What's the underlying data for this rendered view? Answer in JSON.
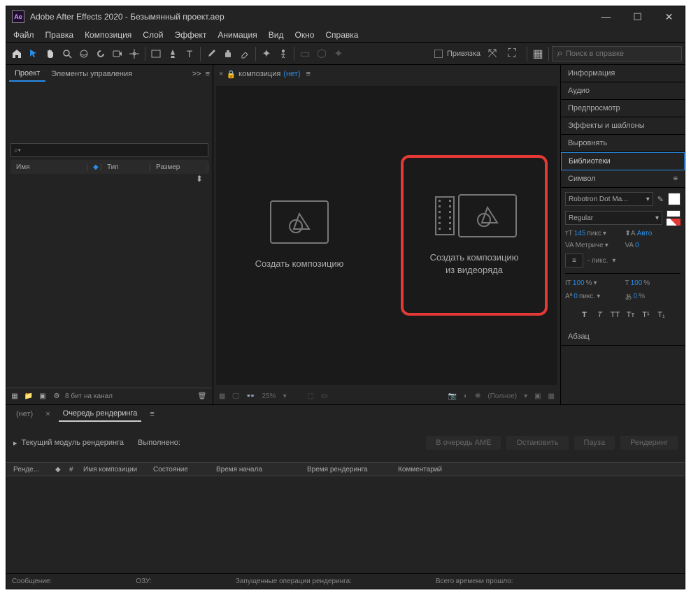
{
  "app": {
    "icon_text": "Ae",
    "title": "Adobe After Effects 2020 - Безымянный проект.aep"
  },
  "menu": {
    "file": "Файл",
    "edit": "Правка",
    "comp": "Композиция",
    "layer": "Слой",
    "effect": "Эффект",
    "anim": "Анимация",
    "view": "Вид",
    "window": "Окно",
    "help": "Справка"
  },
  "toolbar": {
    "snap_label": "Привязка"
  },
  "search": {
    "placeholder": "Поиск в справке"
  },
  "left": {
    "tab_project": "Проект",
    "tab_controls": "Элементы управления",
    "more": ">>",
    "col_name": "Имя",
    "col_type": "Тип",
    "col_size": "Размер",
    "footer_bpc": "8 бит на канал"
  },
  "center": {
    "comp_label": "композиция",
    "comp_none": "(нет)",
    "create_comp": "Создать композицию",
    "create_from": "Создать композицию\nиз видеоряда",
    "zoom": "25%",
    "mode": "(Полное)"
  },
  "right": {
    "info": "Информация",
    "audio": "Аудио",
    "preview": "Предпросмотр",
    "effects": "Эффекты и шаблоны",
    "align": "Выровнять",
    "libraries": "Библиотеки",
    "symbol": "Символ",
    "font": "Robotron Dot Ma...",
    "style": "Regular",
    "size": "145",
    "size_unit": "пикс",
    "leading": "Авто",
    "leading_val": "0",
    "tracking": "Метриче",
    "kerning": "0",
    "stroke": "- пикс.",
    "hscale": "100",
    "vscale": "100",
    "pct": "%",
    "baseline": "0",
    "baseline_unit": "пикс.",
    "tsume": "0",
    "paragraph": "Абзац"
  },
  "bottom": {
    "tab_none": "(нет)",
    "tab_render": "Очередь рендеринга",
    "module": "Текущий модуль рендеринга",
    "done": "Выполнено:",
    "btn_ame": "В очередь AME",
    "btn_stop": "Остановить",
    "btn_pause": "Пауза",
    "btn_render": "Рендеринг",
    "c_render": "Ренде...",
    "c_num": "#",
    "c_name": "Имя композиции",
    "c_state": "Состояние",
    "c_start": "Время начала",
    "c_rtime": "Время рендеринга",
    "c_comment": "Комментарий"
  },
  "status": {
    "msg": "Сообщение:",
    "ram": "ОЗУ:",
    "ops": "Запущенные операции рендеринга:",
    "elapsed": "Всего времени прошло:"
  }
}
